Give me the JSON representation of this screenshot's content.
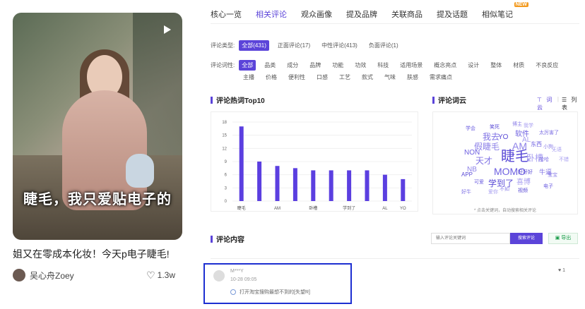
{
  "post": {
    "cover_text": "睫毛，我只爱贴电子的",
    "title": "姐又在零成本化妆！今天p电子睫毛!",
    "author": "吴心舟Zoey",
    "likes": "1.3w"
  },
  "tabs": [
    {
      "label": "核心一览"
    },
    {
      "label": "相关评论"
    },
    {
      "label": "观众画像"
    },
    {
      "label": "提及品牌"
    },
    {
      "label": "关联商品"
    },
    {
      "label": "提及话题"
    },
    {
      "label": "相似笔记",
      "badge": "NEW"
    }
  ],
  "filters": {
    "type_label": "评论类型:",
    "types": [
      "全部(431)",
      "正面评论(17)",
      "中性评论(413)",
      "负面评论(1)"
    ],
    "dim_label": "评论词性:",
    "dims_row1": [
      "全部",
      "品类",
      "成分",
      "品牌",
      "功能",
      "功效",
      "科技",
      "适用场景",
      "概念亮点",
      "设计",
      "整体",
      "材质",
      "不良反应"
    ],
    "dims_row2": [
      "主播",
      "价格",
      "便利性",
      "口感",
      "工艺",
      "款式",
      "气味",
      "肤感",
      "需求痛点"
    ]
  },
  "hot_words": {
    "title": "评论热词Top10",
    "chart_data": {
      "type": "bar",
      "categories": [
        "睫毛",
        "",
        "AM",
        "",
        "卧槽",
        "",
        "学到了",
        "",
        "AL",
        "YO"
      ],
      "values": [
        17,
        9,
        8,
        7.5,
        7,
        7,
        7,
        7,
        6,
        5
      ],
      "yticks": [
        "0",
        "3",
        "6",
        "9",
        "12",
        "15",
        "18"
      ],
      "ylim": [
        0,
        18
      ],
      "color": "#5b3fe0"
    }
  },
  "word_cloud": {
    "title": "评论词云",
    "tab_cloud": "词云",
    "tab_list": "列表",
    "note": "* 点击关键词，自动搜索相关评论",
    "words": [
      "睫毛",
      "MOMO",
      "AM",
      "AL",
      "我去",
      "YO",
      "软件",
      "假睫毛",
      "卧槽",
      "天才",
      "学到了",
      "NON",
      "NB",
      "喜博",
      "牛逼",
      "笑死",
      "学会",
      "博主",
      "我学",
      "太厉害了",
      "好好好",
      "东西",
      "小狗",
      "无语",
      "哈哈",
      "APP",
      "可爱",
      "不如",
      "爱你",
      "好牛",
      "视频",
      "电子",
      "宝宝",
      "不错"
    ]
  },
  "comments": {
    "title": "评论内容",
    "search_placeholder": "输入评论关键词",
    "search_button": "搜索评论",
    "export_button": "导出",
    "items": [
      {
        "user": "M***Y",
        "time": "10-28 09:05",
        "text": "打开淘宝搜购最想不到的[失望R]",
        "likes": "1"
      }
    ]
  }
}
